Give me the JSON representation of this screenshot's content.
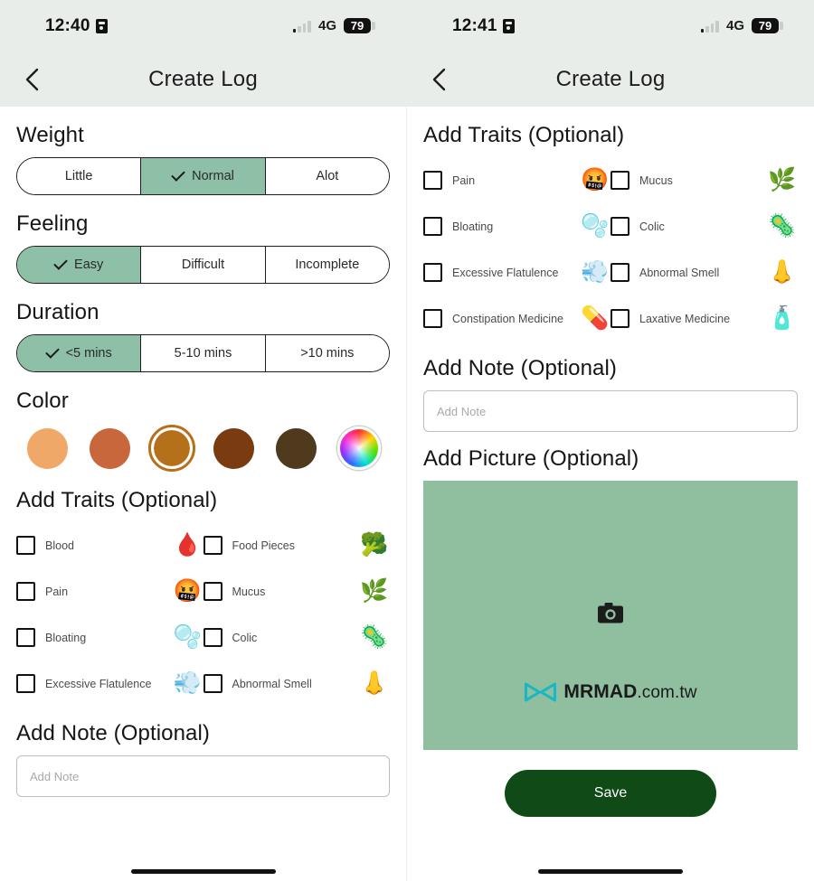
{
  "left": {
    "statusbar": {
      "time": "12:40",
      "network": "4G",
      "battery": "79",
      "alarm_icon": "alarm-icon"
    },
    "navbar": {
      "title": "Create Log",
      "back_icon": "chevron-left-icon"
    },
    "weight": {
      "title": "Weight",
      "options": [
        {
          "label": "Little",
          "selected": false
        },
        {
          "label": "Normal",
          "selected": true
        },
        {
          "label": "Alot",
          "selected": false
        }
      ]
    },
    "feeling": {
      "title": "Feeling",
      "options": [
        {
          "label": "Easy",
          "selected": true
        },
        {
          "label": "Difficult",
          "selected": false
        },
        {
          "label": "Incomplete",
          "selected": false
        }
      ]
    },
    "duration": {
      "title": "Duration",
      "options": [
        {
          "label": "<5 mins",
          "selected": true
        },
        {
          "label": "5-10 mins",
          "selected": false
        },
        {
          "label": ">10 mins",
          "selected": false
        }
      ]
    },
    "color": {
      "title": "Color",
      "swatches": [
        {
          "name": "color-swatch-light-tan",
          "hex": "#F0A868",
          "selected": false
        },
        {
          "name": "color-swatch-sienna",
          "hex": "#C8663C",
          "selected": false
        },
        {
          "name": "color-swatch-ochre-brown",
          "hex": "#B5701C",
          "selected": true
        },
        {
          "name": "color-swatch-dark-brown",
          "hex": "#7A3B11",
          "selected": false
        },
        {
          "name": "color-swatch-darkest-brown",
          "hex": "#4F3A1E",
          "selected": false
        },
        {
          "name": "color-swatch-custom-picker",
          "hex": "rainbow",
          "selected": false
        }
      ]
    },
    "traits": {
      "title": "Add Traits (Optional)",
      "rows": [
        [
          {
            "label": "Blood",
            "emoji": "🩸",
            "icon_name": "blood-drop-icon",
            "checked": false
          },
          {
            "label": "Food Pieces",
            "emoji": "🥦",
            "icon_name": "vegetables-icon",
            "checked": false
          }
        ],
        [
          {
            "label": "Pain",
            "emoji": "🤬",
            "icon_name": "pain-face-icon",
            "checked": false
          },
          {
            "label": "Mucus",
            "emoji": "🌿",
            "icon_name": "mucus-icon",
            "checked": false
          }
        ],
        [
          {
            "label": "Bloating",
            "emoji": "🫧",
            "icon_name": "bloating-icon",
            "checked": false
          },
          {
            "label": "Colic",
            "emoji": "🦠",
            "icon_name": "intestine-icon",
            "checked": false
          }
        ],
        [
          {
            "label": "Excessive Flatulence",
            "emoji": "💨",
            "icon_name": "flatulence-icon",
            "checked": false
          },
          {
            "label": "Abnormal Smell",
            "emoji": "👃",
            "icon_name": "nose-smell-icon",
            "checked": false
          }
        ]
      ]
    },
    "note": {
      "title": "Add Note (Optional)",
      "placeholder": "Add Note",
      "value": ""
    }
  },
  "right": {
    "statusbar": {
      "time": "12:41",
      "network": "4G",
      "battery": "79",
      "alarm_icon": "alarm-icon"
    },
    "navbar": {
      "title": "Create Log",
      "back_icon": "chevron-left-icon"
    },
    "traits": {
      "title": "Add Traits (Optional)",
      "rows": [
        [
          {
            "label": "Pain",
            "emoji": "🤬",
            "icon_name": "pain-face-icon",
            "checked": false
          },
          {
            "label": "Mucus",
            "emoji": "🌿",
            "icon_name": "mucus-icon",
            "checked": false
          }
        ],
        [
          {
            "label": "Bloating",
            "emoji": "🫧",
            "icon_name": "bloating-icon",
            "checked": false
          },
          {
            "label": "Colic",
            "emoji": "🦠",
            "icon_name": "intestine-icon",
            "checked": false
          }
        ],
        [
          {
            "label": "Excessive Flatulence",
            "emoji": "💨",
            "icon_name": "flatulence-icon",
            "checked": false
          },
          {
            "label": "Abnormal Smell",
            "emoji": "👃",
            "icon_name": "nose-smell-icon",
            "checked": false
          }
        ],
        [
          {
            "label": "Constipation Medicine",
            "emoji": "💊",
            "icon_name": "pill-icon",
            "checked": false
          },
          {
            "label": "Laxative Medicine",
            "emoji": "🧴",
            "icon_name": "syrup-bottle-icon",
            "checked": false
          }
        ]
      ]
    },
    "note": {
      "title": "Add Note (Optional)",
      "placeholder": "Add Note",
      "value": ""
    },
    "picture": {
      "title": "Add Picture (Optional)",
      "background": "#8FBF9F",
      "camera_icon": "camera-icon",
      "watermark_brand": "MRMAD",
      "watermark_suffix": ".com.tw"
    },
    "save": {
      "label": "Save",
      "color": "#0F4A17"
    }
  }
}
